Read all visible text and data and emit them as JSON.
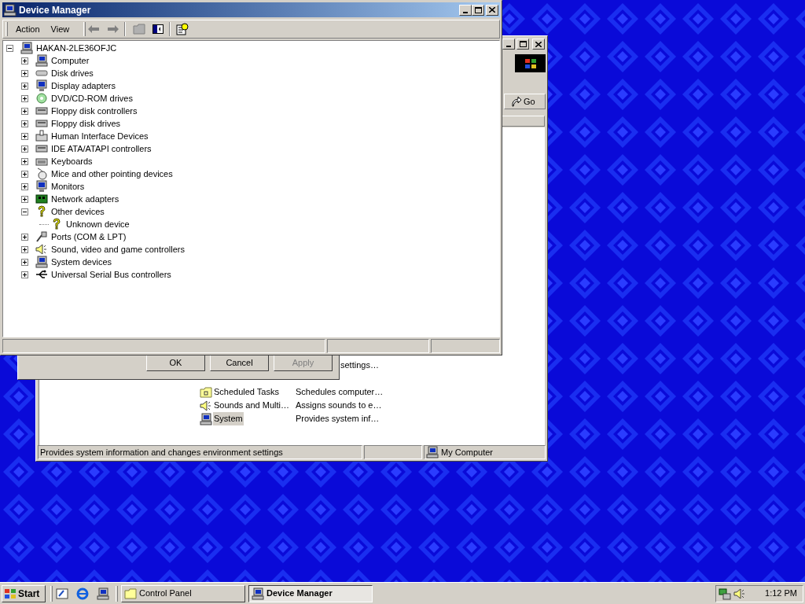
{
  "device_manager": {
    "title": "Device Manager",
    "menu": [
      "Action",
      "View"
    ],
    "tree": {
      "label": "HAKAN-2LE36OFJC",
      "expanded": true,
      "children": [
        {
          "label": "Computer",
          "expanded": false
        },
        {
          "label": "Disk drives",
          "expanded": false
        },
        {
          "label": "Display adapters",
          "expanded": false
        },
        {
          "label": "DVD/CD-ROM drives",
          "expanded": false
        },
        {
          "label": "Floppy disk controllers",
          "expanded": false
        },
        {
          "label": "Floppy disk drives",
          "expanded": false
        },
        {
          "label": "Human Interface Devices",
          "expanded": false
        },
        {
          "label": "IDE ATA/ATAPI controllers",
          "expanded": false
        },
        {
          "label": "Keyboards",
          "expanded": false
        },
        {
          "label": "Mice and other pointing devices",
          "expanded": false
        },
        {
          "label": "Monitors",
          "expanded": false
        },
        {
          "label": "Network adapters",
          "expanded": false
        },
        {
          "label": "Other devices",
          "expanded": true,
          "children": [
            {
              "label": "Unknown device"
            }
          ]
        },
        {
          "label": "Ports (COM & LPT)",
          "expanded": false
        },
        {
          "label": "Sound, video and game controllers",
          "expanded": false
        },
        {
          "label": "System devices",
          "expanded": false
        },
        {
          "label": "Universal Serial Bus controllers",
          "expanded": false
        }
      ]
    }
  },
  "dialog": {
    "buttons": [
      {
        "label": "OK",
        "disabled": false
      },
      {
        "label": "Cancel",
        "disabled": false
      },
      {
        "label": "Apply",
        "disabled": true
      }
    ]
  },
  "control_panel": {
    "go_button": "Go",
    "items": [
      {
        "description": "settings…",
        "selected": false
      },
      {
        "name": "Scheduled Tasks",
        "description": "Schedules computer…",
        "selected": false
      },
      {
        "name": "Sounds and Multi…",
        "description": "Assigns sounds to e…",
        "selected": false
      },
      {
        "name": "System",
        "description": "Provides system inf…",
        "selected": true
      }
    ],
    "status_bar": {
      "text": "Provides system information and changes environment settings",
      "zone": "My Computer"
    }
  },
  "taskbar": {
    "start": "Start",
    "tasks": [
      {
        "label": "Control Panel",
        "selected": false
      },
      {
        "label": "Device Manager",
        "selected": true
      }
    ],
    "clock": "1:12 PM"
  }
}
